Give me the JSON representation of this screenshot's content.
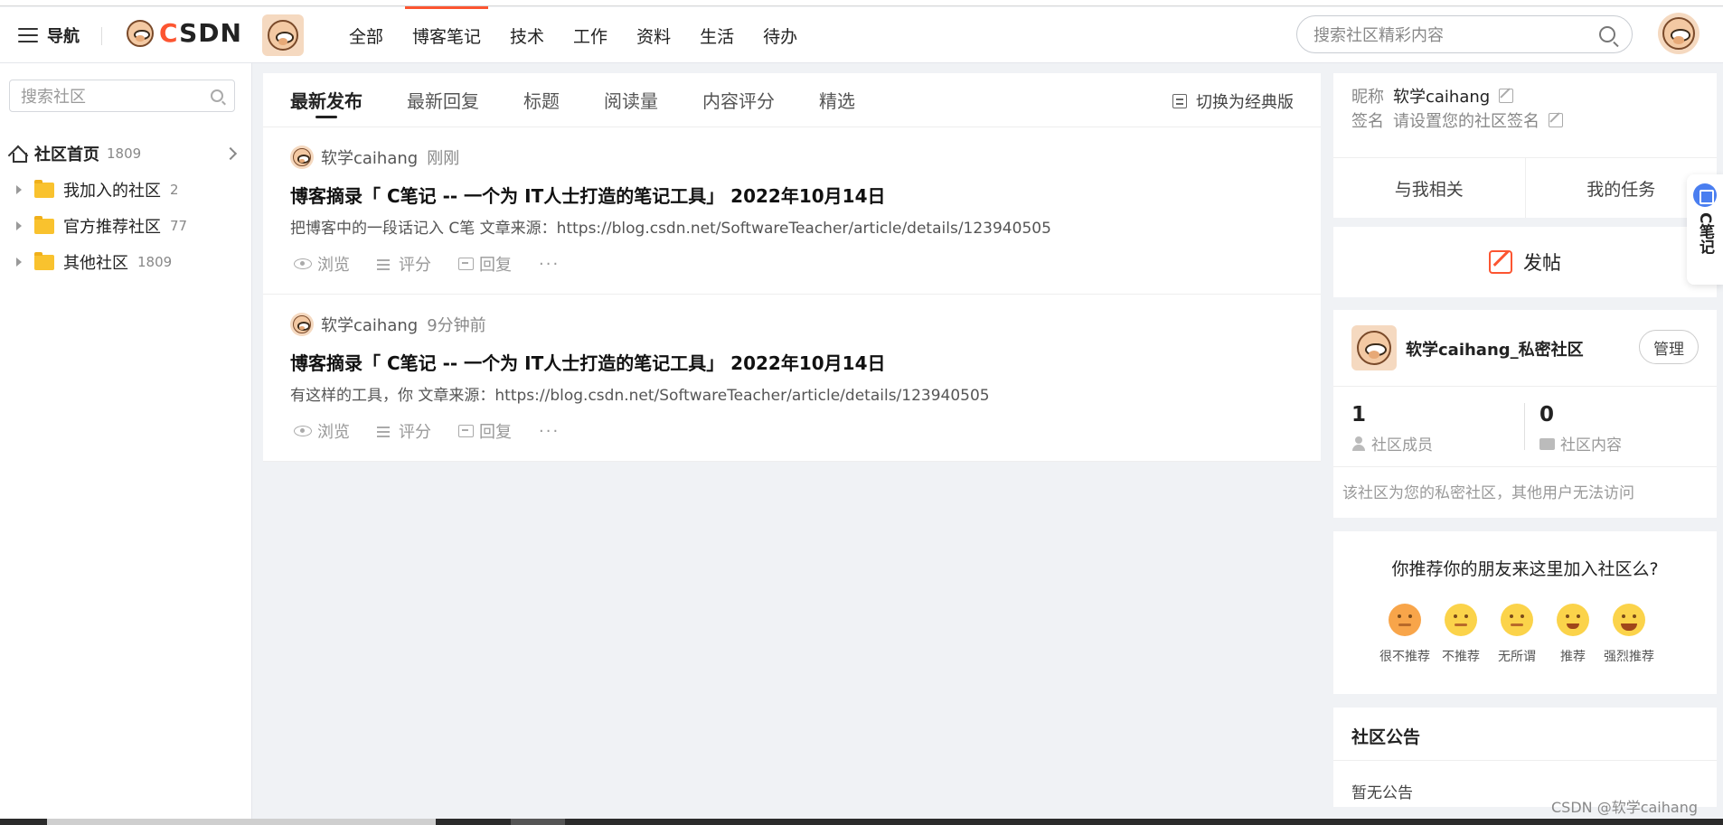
{
  "header": {
    "nav_label": "导航",
    "logo_c": "C",
    "logo_rest": "SDN",
    "tabs": [
      "全部",
      "博客笔记",
      "技术",
      "工作",
      "资料",
      "生活",
      "待办"
    ],
    "active_tab": "博客笔记",
    "search_placeholder": "搜索社区精彩内容"
  },
  "sidebar": {
    "search_placeholder": "搜索社区",
    "home": {
      "label": "社区首页",
      "count": "1809"
    },
    "items": [
      {
        "label": "我加入的社区",
        "count": "2"
      },
      {
        "label": "官方推荐社区",
        "count": "77"
      },
      {
        "label": "其他社区",
        "count": "1809"
      }
    ]
  },
  "main": {
    "tabs": [
      "最新发布",
      "最新回复",
      "标题",
      "阅读量",
      "内容评分",
      "精选"
    ],
    "active_tab": "最新发布",
    "switch_label": "切换为经典版",
    "actions": {
      "view": "浏览",
      "rate": "评分",
      "reply": "回复",
      "more": "···"
    },
    "posts": [
      {
        "author": "软学caihang",
        "time": "刚刚",
        "title": "博客摘录「 C笔记 -- 一个为 IT人士打造的笔记工具」 2022年10月14日",
        "summary": "把博客中的一段话记入 C笔 文章来源：https://blog.csdn.net/SoftwareTeacher/article/details/123940505"
      },
      {
        "author": "软学caihang",
        "time": "9分钟前",
        "title": "博客摘录「 C笔记 -- 一个为 IT人士打造的笔记工具」 2022年10月14日",
        "summary": "有这样的工具，你 文章来源：https://blog.csdn.net/SoftwareTeacher/article/details/123940505"
      }
    ]
  },
  "profile": {
    "nickname_label": "昵称",
    "nickname": "软学caihang",
    "sign_label": "签名",
    "sign_placeholder": "请设置您的社区签名",
    "tabs": [
      "与我相关",
      "我的任务"
    ]
  },
  "post_button": "发帖",
  "community": {
    "name": "软学caihang_私密社区",
    "manage": "管理",
    "members_num": "1",
    "members_label": "社区成员",
    "content_num": "0",
    "content_label": "社区内容",
    "note": "该社区为您的私密社区，其他用户无法访问"
  },
  "recommend": {
    "question": "你推荐你的朋友来这里加入社区么?",
    "options": [
      "很不推荐",
      "不推荐",
      "无所谓",
      "推荐",
      "强烈推荐"
    ]
  },
  "notice": {
    "title": "社区公告",
    "body": "暂无公告"
  },
  "float_widget": {
    "text": "C笔记"
  },
  "watermark": "CSDN @软学caihang",
  "colors": {
    "brand": "#fc5531",
    "bg": "#f0f2f5",
    "folder": "#f9c22e",
    "widget_accent": "#4a7ef0"
  }
}
